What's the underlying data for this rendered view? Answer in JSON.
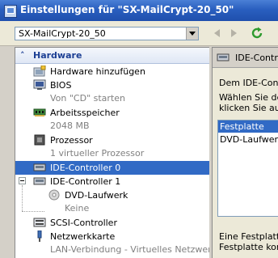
{
  "window": {
    "title": "Einstellungen für \"SX-MailCrypt-20_50\""
  },
  "toolbar": {
    "vm_selector_value": "SX-MailCrypt-20_50"
  },
  "hardware": {
    "section_title": "Hardware",
    "items": [
      {
        "label": "Hardware hinzufügen"
      },
      {
        "label": "BIOS",
        "detail": "Von \"CD\" starten"
      },
      {
        "label": "Arbeitsspeicher",
        "detail": "2048 MB"
      },
      {
        "label": "Prozessor",
        "detail": "1 virtueller Prozessor"
      },
      {
        "label": "IDE-Controller 0"
      },
      {
        "label": "IDE-Controller 1"
      },
      {
        "label": "DVD-Laufwerk",
        "detail": "Keine"
      },
      {
        "label": "SCSI-Controller"
      },
      {
        "label": "Netzwerkkarte",
        "detail": "LAN-Verbindung - Virtuelles Netzwerk"
      }
    ]
  },
  "details": {
    "header": "IDE-Contro",
    "line1": "Dem IDE-Contr",
    "line2": "Wählen Sie de",
    "line3": "klicken Sie auf",
    "device_list": [
      "Festplatte",
      "DVD-Laufwerk"
    ],
    "footer1": "Eine Festplatte",
    "footer2": "Festplatte konf"
  },
  "colors": {
    "selection": "#316ac5",
    "title_bar": "#2a5fbf",
    "section_text": "#1c3f94"
  }
}
